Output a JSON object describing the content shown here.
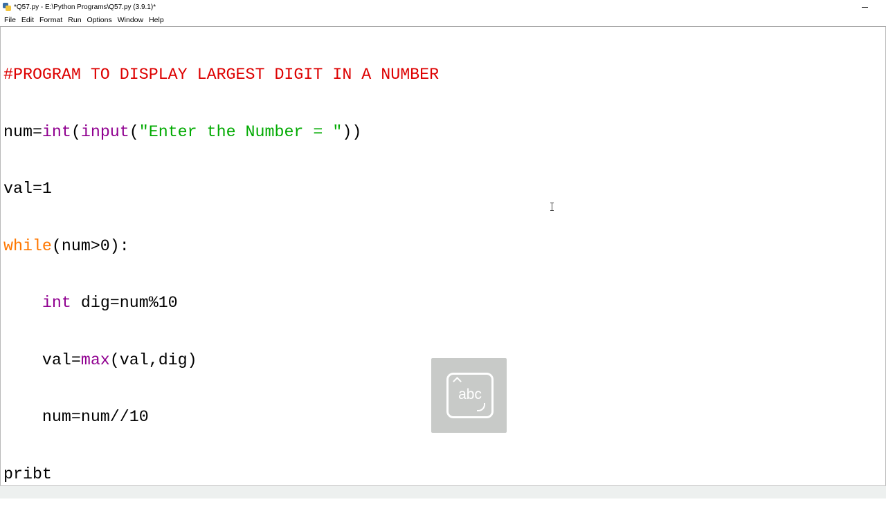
{
  "window": {
    "title": "*Q57.py - E:\\Python Programs\\Q57.py (3.9.1)*"
  },
  "menu": [
    "File",
    "Edit",
    "Format",
    "Run",
    "Options",
    "Window",
    "Help"
  ],
  "code": {
    "line1": {
      "comment": "#PROGRAM TO DISPLAY LARGEST DIGIT IN A NUMBER"
    },
    "line2": {
      "a": "num=",
      "int": "int",
      "open": "(",
      "input": "input",
      "open2": "(",
      "str": "\"Enter the Number = \"",
      "close": "))"
    },
    "line3": {
      "text": "val=1"
    },
    "line4": {
      "kw": "while",
      "rest": "(num>0):"
    },
    "line5": {
      "indent": "    ",
      "int": "int",
      "rest": " dig=num%10"
    },
    "line6": {
      "indent": "    ",
      "a": "val=",
      "max": "max",
      "rest": "(val,dig)"
    },
    "line7": {
      "text": "    num=num//10"
    },
    "line8": {
      "text": "pribt"
    }
  },
  "widget": {
    "label": "abc"
  },
  "colors": {
    "comment": "#dd0000",
    "builtin": "#900090",
    "string": "#00aa00",
    "keyword": "#ff7700",
    "status_bar": "#edf0ef"
  }
}
